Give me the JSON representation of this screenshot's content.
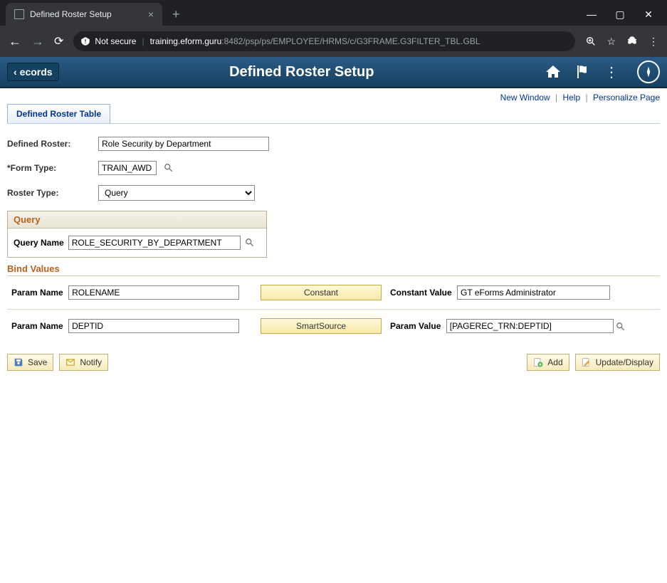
{
  "browser": {
    "tab_title": "Defined Roster Setup",
    "not_secure": "Not secure",
    "url_host": "training.eform.guru",
    "url_port": ":8482",
    "url_path": "/psp/ps/EMPLOYEE/HRMS/c/G3FRAME.G3FILTER_TBL.GBL"
  },
  "header": {
    "back_label": "ecords",
    "title": "Defined Roster Setup"
  },
  "links": {
    "new_window": "New Window",
    "help": "Help",
    "personalize": "Personalize Page"
  },
  "tab": {
    "label": "Defined Roster Table"
  },
  "fields": {
    "defined_roster_label": "Defined Roster:",
    "defined_roster_value": "Role Security by Department",
    "form_type_label": "*Form Type:",
    "form_type_value": "TRAIN_AWD",
    "roster_type_label": "Roster Type:",
    "roster_type_value": "Query"
  },
  "query_group": {
    "title": "Query",
    "name_label": "Query Name",
    "name_value": "ROLE_SECURITY_BY_DEPARTMENT"
  },
  "bind": {
    "title": "Bind Values",
    "param_name_label": "Param Name",
    "rows": [
      {
        "param": "ROLENAME",
        "btn": "Constant",
        "val_label": "Constant Value",
        "val": "GT eForms Administrator"
      },
      {
        "param": "DEPTID",
        "btn": "SmartSource",
        "val_label": "Param Value",
        "val": "[PAGEREC_TRN:DEPTID]"
      }
    ]
  },
  "actions": {
    "save": "Save",
    "notify": "Notify",
    "add": "Add",
    "update": "Update/Display"
  }
}
